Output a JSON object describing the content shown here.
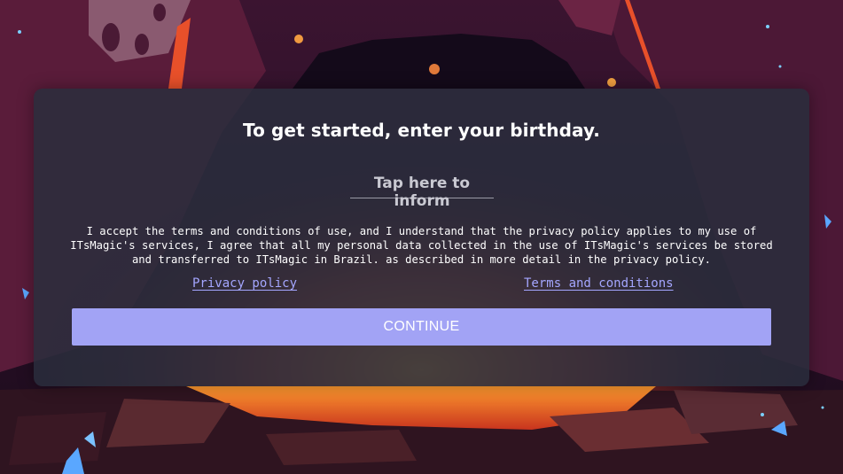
{
  "dialog": {
    "title": "To get started, enter your birthday.",
    "birthday_field_label": "Tap here to inform",
    "terms_text": "I accept the terms and conditions of use, and I understand that the privacy policy applies to my use of ITsMagic's services, I agree that all my personal data collected in the use of ITsMagic's services be stored and transferred to ITsMagic in Brazil. as described in more detail in the privacy policy.",
    "privacy_link": "Privacy policy",
    "terms_link": "Terms and conditions",
    "continue_label": "CONTINUE"
  },
  "colors": {
    "accent": "#a2a3f5",
    "link": "#a4a6ff",
    "panel": "#2a2d3c",
    "lava": "#e8502a"
  }
}
